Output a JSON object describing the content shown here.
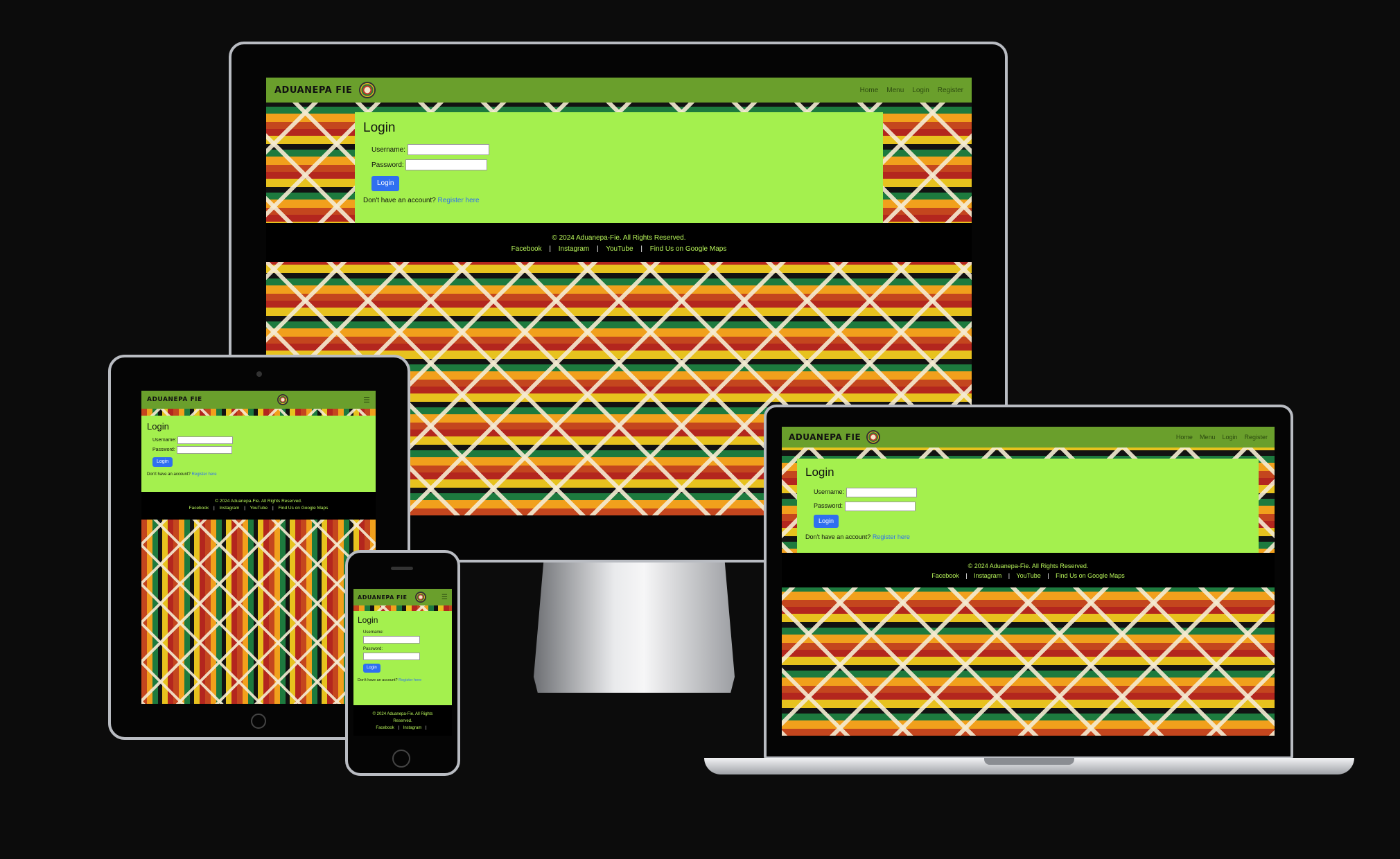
{
  "site": {
    "brand": "ADUANEPA FIE",
    "nav": [
      "Home",
      "Menu",
      "Login",
      "Register"
    ],
    "menu_icon": "hamburger-icon",
    "logo_icon": "emblem-logo-icon"
  },
  "login": {
    "title": "Login",
    "username_label": "Username:",
    "password_label": "Password:",
    "button": "Login",
    "prompt": "Don't have an account?",
    "register_link": "Register here"
  },
  "footer": {
    "copyright": "© 2024 Aduanepa-Fie. All Rights Reserved.",
    "copyright_phone_1": "© 2024 Aduanepa-Fie. All Rights",
    "copyright_phone_2": "Reserved.",
    "links": [
      "Facebook",
      "Instagram",
      "YouTube",
      "Find Us on Google Maps"
    ],
    "sep": "|"
  },
  "colors": {
    "nav": "#6a9f2c",
    "card": "#a4f04e",
    "button": "#2f6ff0",
    "footer_text": "#b8f55a",
    "background": "#0c0c0c"
  }
}
